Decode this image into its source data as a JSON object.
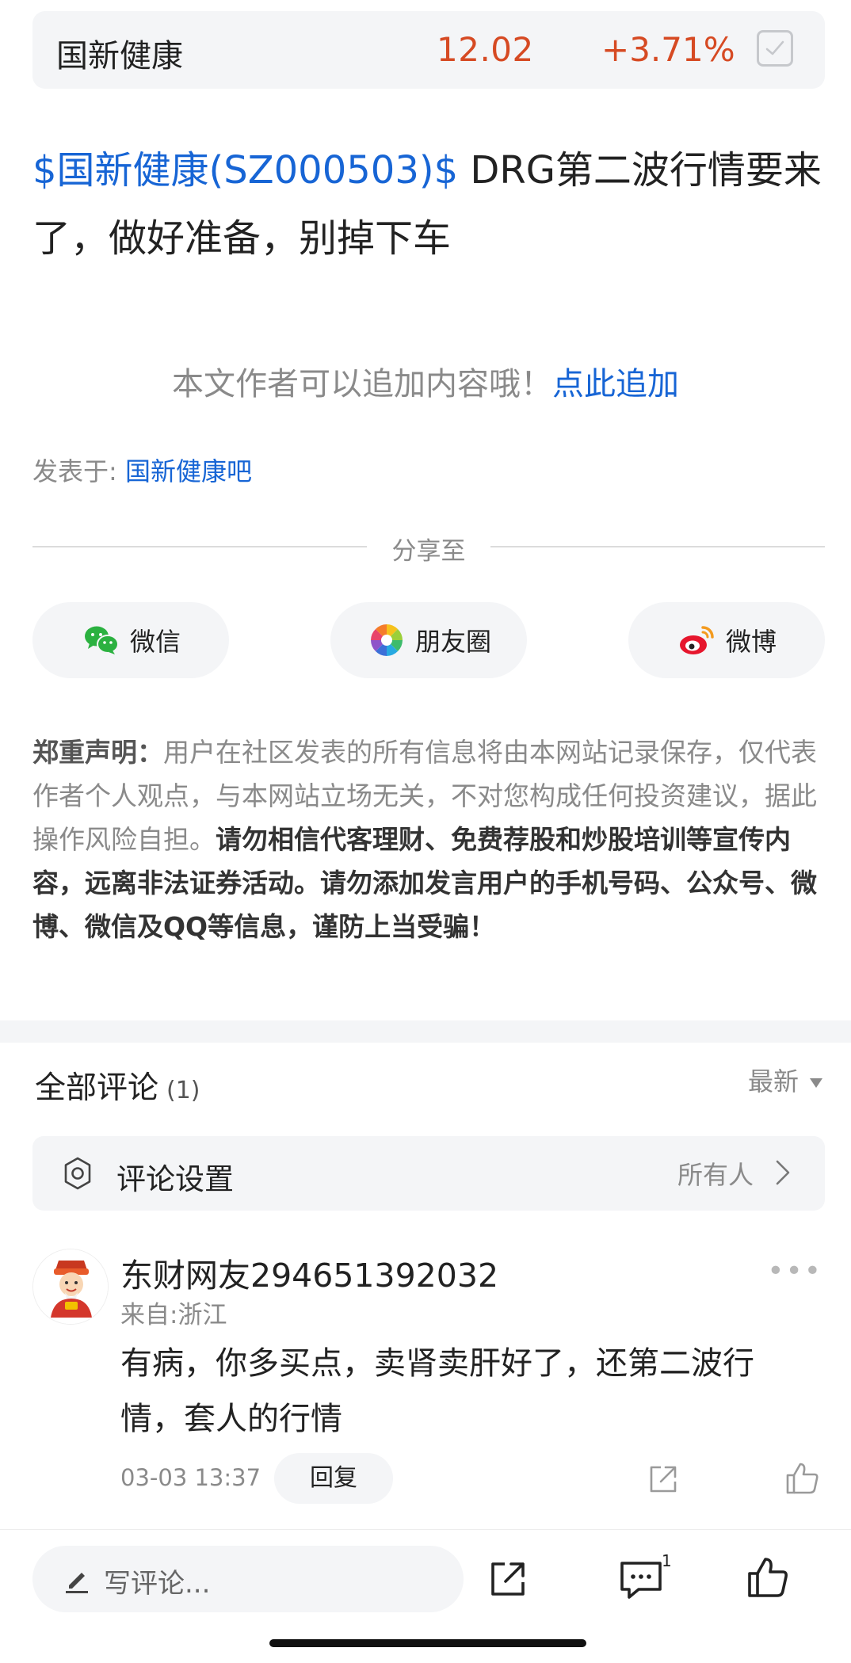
{
  "stock": {
    "name": "国新健康",
    "price": "12.02",
    "change": "+3.71%"
  },
  "post": {
    "stock_tag": "$国新健康(SZ000503)$",
    "body": " DRG第二波行情要来了，做好准备，别掉下车"
  },
  "append": {
    "hint": "本文作者可以追加内容哦！",
    "link": "点此追加"
  },
  "posted_in": {
    "label": "发表于: ",
    "bar": "国新健康吧"
  },
  "share": {
    "title": "分享至",
    "wechat": "微信",
    "moments": "朋友圈",
    "weibo": "微博"
  },
  "disclaimer": {
    "lead": "郑重声明：",
    "text": "用户在社区发表的所有信息将由本网站记录保存，仅代表作者个人观点，与本网站立场无关，不对您构成任何投资建议，据此操作风险自担。",
    "warning": "请勿相信代客理财、免费荐股和炒股培训等宣传内容，远离非法证券活动。请勿添加发言用户的手机号码、公众号、微博、微信及QQ等信息，谨防上当受骗！"
  },
  "comments": {
    "title": "全部评论",
    "count": "(1)",
    "sort": "最新",
    "settings_label": "评论设置",
    "settings_value": "所有人",
    "items": [
      {
        "user": "东财网友294651392032",
        "location": "来自:浙江",
        "text": "有病，你多买点，卖肾卖肝好了，还第二波行情，套人的行情",
        "time": "03-03 13:37",
        "reply": "回复",
        "more": "•••"
      }
    ]
  },
  "bottom_bar": {
    "placeholder": "写评论...",
    "comment_count": "1"
  },
  "colors": {
    "link_blue": "#1765d5",
    "price_red": "#d64a23",
    "muted": "#8a8a8a",
    "panel": "#f4f5f7"
  }
}
